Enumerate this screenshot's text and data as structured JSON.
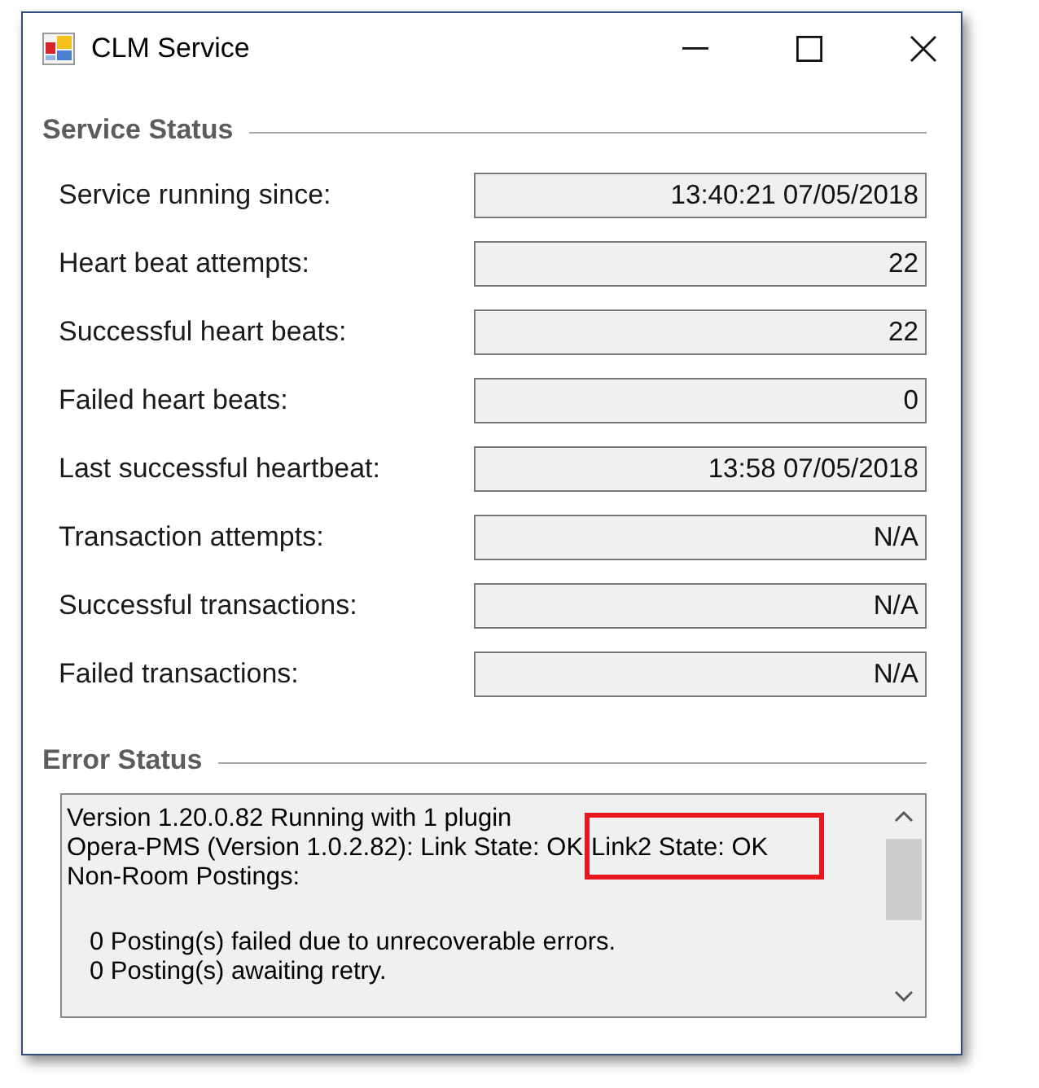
{
  "window": {
    "title": "CLM Service"
  },
  "service_status": {
    "heading": "Service Status",
    "rows": [
      {
        "label": "Service running since:",
        "value": "13:40:21 07/05/2018"
      },
      {
        "label": "Heart beat attempts:",
        "value": "22"
      },
      {
        "label": "Successful heart beats:",
        "value": "22"
      },
      {
        "label": "Failed heart beats:",
        "value": "0"
      },
      {
        "label": "Last successful heartbeat:",
        "value": "13:58 07/05/2018"
      },
      {
        "label": "Transaction attempts:",
        "value": "N/A"
      },
      {
        "label": "Successful transactions:",
        "value": "N/A"
      },
      {
        "label": "Failed transactions:",
        "value": "N/A"
      }
    ]
  },
  "error_status": {
    "heading": "Error Status",
    "paragraphs": [
      {
        "indented": false,
        "lines": [
          {
            "segments": [
              {
                "text": "Version 1.20.0.82 Running with 1 plugin",
                "highlighted": false
              }
            ]
          },
          {
            "segments": [
              {
                "text": "Opera-PMS (Version 1.0.2.82): Link State: OK",
                "highlighted": false
              },
              {
                "text": "Link2 State: OK",
                "highlighted": true
              }
            ]
          },
          {
            "segments": [
              {
                "text": "Non-Room Postings:",
                "highlighted": false
              }
            ]
          }
        ]
      },
      {
        "indented": true,
        "lines": [
          {
            "segments": [
              {
                "text": "0 Posting(s) failed due to unrecoverable errors.",
                "highlighted": false
              }
            ]
          },
          {
            "segments": [
              {
                "text": "0 Posting(s) awaiting retry.",
                "highlighted": false
              }
            ]
          }
        ]
      }
    ]
  }
}
